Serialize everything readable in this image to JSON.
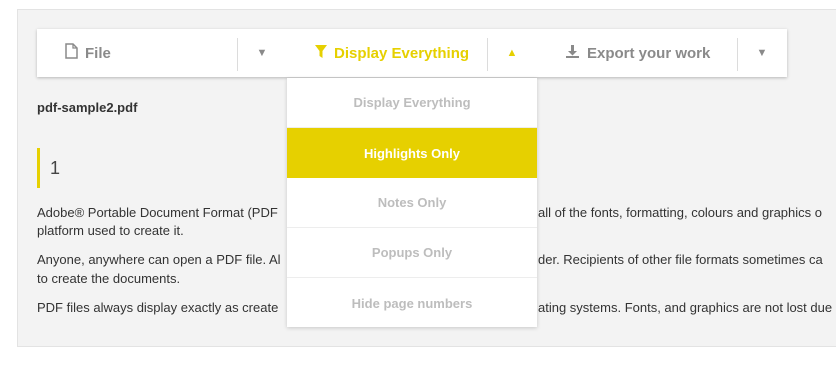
{
  "toolbar": {
    "file_label": "File",
    "display_label": "Display Everything",
    "export_label": "Export your work",
    "caret_down": "▼",
    "caret_up": "▲"
  },
  "dropdown": {
    "items": [
      "Display Everything",
      "Highlights Only",
      "Notes Only",
      "Popups Only",
      "Hide page numbers"
    ],
    "active_index": 1
  },
  "document": {
    "filename": "pdf-sample2.pdf",
    "page_number": "1",
    "paragraphs": [
      {
        "line1": "Adobe® Portable Document Format (PDF",
        "line1b": "all of the fonts, formatting, colours and graphics o",
        "line2": "platform used to create it."
      },
      {
        "line1": "Anyone, anywhere can open a PDF file. Al",
        "line1b": "der. Recipients of other file formats sometimes ca",
        "line2": "to create the documents."
      },
      {
        "line1": "PDF files always display exactly as create",
        "line1b": "ating systems. Fonts, and graphics are not lost due"
      }
    ]
  },
  "colors": {
    "accent": "#e6d000",
    "muted": "#8a8a8a"
  }
}
